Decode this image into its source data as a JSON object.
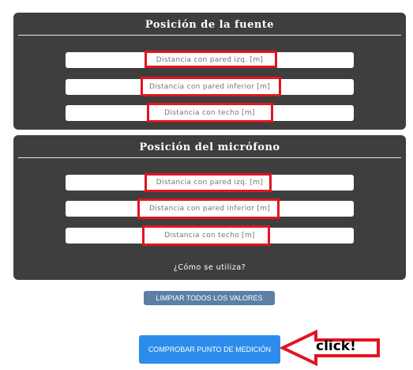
{
  "source_panel": {
    "title": "Posición de la fuente",
    "fields": [
      {
        "placeholder": "Distancia con pared izq. [m]",
        "value": ""
      },
      {
        "placeholder": "Distancia con pared inferior [m]",
        "value": ""
      },
      {
        "placeholder": "Distancia con techo [m]",
        "value": ""
      }
    ]
  },
  "mic_panel": {
    "title": "Posición del micrófono",
    "fields": [
      {
        "placeholder": "Distancia con pared izq. [m]",
        "value": ""
      },
      {
        "placeholder": "Distancia con pared inferior [m]",
        "value": ""
      },
      {
        "placeholder": "Distancia con techo [m]",
        "value": ""
      }
    ],
    "help_link": "¿Cómo se utiliza?"
  },
  "buttons": {
    "clear_label": "LIMPIAR TODOS LOS VALORES",
    "check_label": "COMPROBAR PUNTO DE MEDICIÓN"
  },
  "annotation": {
    "arrow_text": "click!",
    "highlight_color": "#e3141f"
  },
  "colors": {
    "panel_bg": "#3e3e3e",
    "clear_button": "#5b7fa5",
    "check_button": "#2d8ceb"
  }
}
